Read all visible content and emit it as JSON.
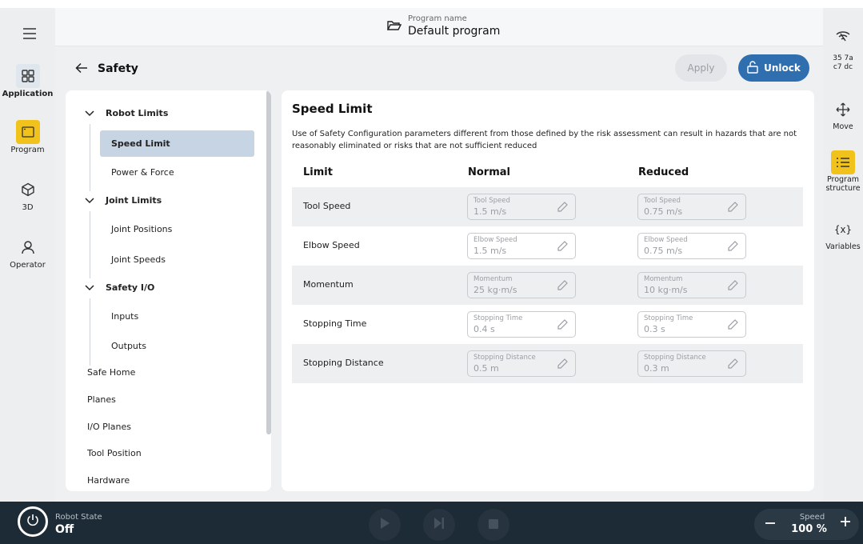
{
  "left_rail": {
    "items": [
      {
        "label": "Application",
        "icon": "grid-icon"
      },
      {
        "label": "Program",
        "icon": "program-window-icon"
      },
      {
        "label": "3D",
        "icon": "cube-icon"
      },
      {
        "label": "Operator",
        "icon": "user-icon"
      }
    ]
  },
  "right_rail": {
    "id_text": "35 7a\nc7 dc",
    "items": [
      {
        "label": "Move",
        "icon": "move-arrows-icon"
      },
      {
        "label": "Program structure",
        "icon": "list-icon"
      },
      {
        "label": "Variables",
        "icon": "variables-icon",
        "glyph": "{x}"
      }
    ]
  },
  "topbar": {
    "program_label": "Program name",
    "program_name": "Default program"
  },
  "header": {
    "title": "Safety",
    "apply_label": "Apply",
    "unlock_label": "Unlock"
  },
  "tree": {
    "groups": [
      {
        "label": "Robot Limits",
        "children": [
          "Speed Limit",
          "Power & Force"
        ]
      },
      {
        "label": "Joint Limits",
        "children": [
          "Joint Positions",
          "Joint Speeds"
        ]
      },
      {
        "label": "Safety I/O",
        "children": [
          "Inputs",
          "Outputs"
        ]
      }
    ],
    "items": [
      "Safe Home",
      "Planes",
      "I/O Planes",
      "Tool Position",
      "Hardware"
    ],
    "selected": "Speed Limit"
  },
  "content": {
    "title": "Speed Limit",
    "description": "Use of Safety Configuration parameters different from those defined by the risk assessment can result in hazards that are not reasonably eliminated or risks that are not sufficient reduced",
    "columns": [
      "Limit",
      "Normal",
      "Reduced"
    ],
    "rows": [
      {
        "label": "Tool Speed",
        "normal": {
          "label": "Tool Speed",
          "value": "1.5 m/s"
        },
        "reduced": {
          "label": "Tool Speed",
          "value": "0.75 m/s"
        }
      },
      {
        "label": "Elbow Speed",
        "normal": {
          "label": "Elbow Speed",
          "value": "1.5 m/s"
        },
        "reduced": {
          "label": "Elbow Speed",
          "value": "0.75 m/s"
        }
      },
      {
        "label": "Momentum",
        "normal": {
          "label": "Momentum",
          "value": "25 kg·m/s"
        },
        "reduced": {
          "label": "Momentum",
          "value": "10 kg·m/s"
        }
      },
      {
        "label": "Stopping Time",
        "normal": {
          "label": "Stopping Time",
          "value": "0.4 s"
        },
        "reduced": {
          "label": "Stopping Time",
          "value": "0.3 s"
        }
      },
      {
        "label": "Stopping Distance",
        "normal": {
          "label": "Stopping Distance",
          "value": "0.5 m"
        },
        "reduced": {
          "label": "Stopping Distance",
          "value": "0.3 m"
        }
      }
    ]
  },
  "bottombar": {
    "robot_state_label": "Robot State",
    "robot_state_value": "Off",
    "speed_label": "Speed",
    "speed_value": "100 %"
  },
  "colors": {
    "accent": "#2f6fb0",
    "active_yellow": "#f1c21b",
    "selected_tree": "#c6d4e3",
    "bottombar": "#1d2b36"
  }
}
